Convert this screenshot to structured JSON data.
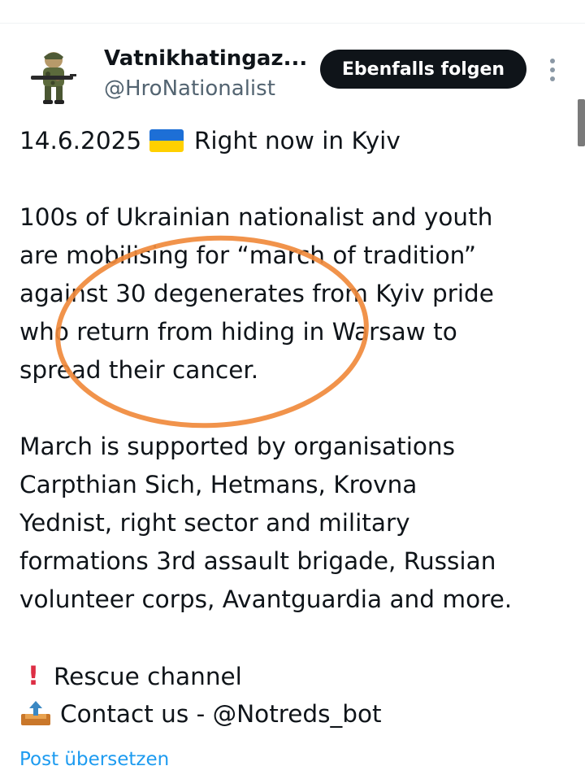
{
  "header": {
    "display_name": "Vatnikhatingaz...",
    "handle": "@HroNationalist",
    "follow_label": "Ebenfalls folgen",
    "more_icon": "more-vertical-icon",
    "avatar_icon": "soldier-avatar"
  },
  "tweet": {
    "date": "14.6.2025",
    "flag_icon": "ukraine-flag-icon",
    "intro": "Right now in Kyiv",
    "paragraph1": [
      "100s of Ukrainian nationalist and youth",
      "are mobilising for “march of tradition”",
      "against 30 degenerates from Kyiv pride",
      "who return from hiding in Warsaw to",
      "spread their cancer."
    ],
    "paragraph2": [
      "March is supported by organisations",
      "Carpthian Sich, Hetmans, Krovna",
      "Yednist, right sector and military",
      "formations 3rd assault brigade, Russian",
      "volunteer corps, Avantguardia and more."
    ],
    "rescue_icon": "red-exclamation-icon",
    "rescue_text": "Rescue channel",
    "contact_icon": "outbox-tray-icon",
    "contact_text": "Contact us - @Notreds_bot"
  },
  "footer": {
    "translate_label": "Post übersetzen"
  },
  "colors": {
    "text": "#0f1419",
    "secondary": "#536471",
    "link": "#1d9bf0",
    "button_bg": "#0f1419",
    "annotation": "#f08a3c",
    "flag_blue": "#1d6fd6",
    "flag_yellow": "#ffd000"
  }
}
